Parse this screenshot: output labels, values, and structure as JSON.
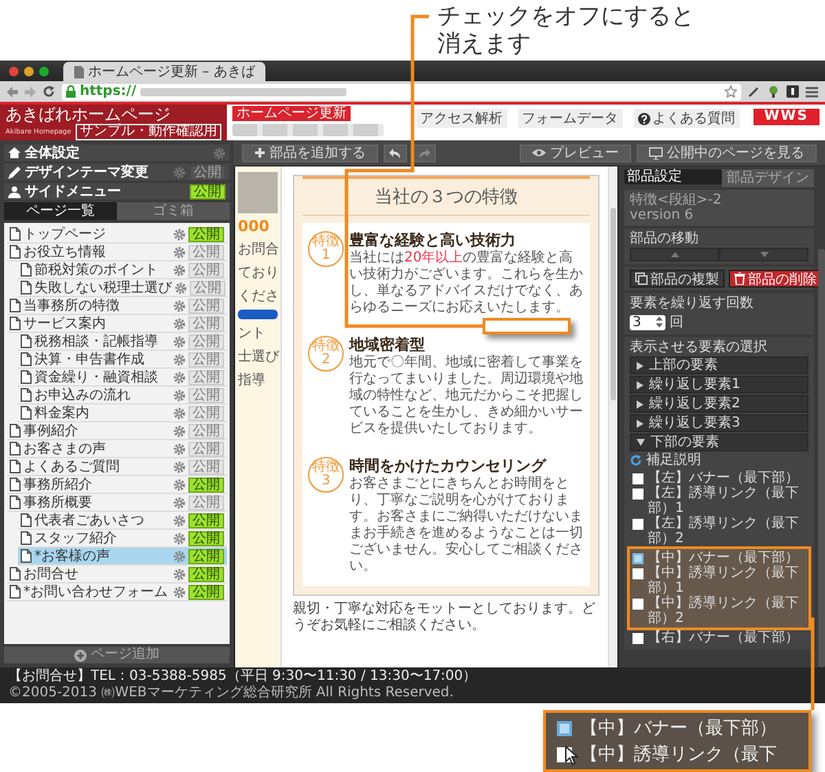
{
  "annotation": {
    "lines": [
      "チェックをオフにすると",
      "消えます"
    ]
  },
  "browser": {
    "tab_title": "ホームページ更新 – あきば",
    "url_scheme": "https://"
  },
  "site_header": {
    "logo_title": "あきばれホームページ",
    "logo_subtitle": "Akibare Homepage",
    "logo_badge": "サンプル・動作確認用",
    "tag": "ホームページ更新",
    "links": [
      {
        "label": "アクセス解析",
        "kind": "plain"
      },
      {
        "label": "フォームデータ",
        "kind": "plain"
      },
      {
        "label": "よくある質問",
        "kind": "help"
      }
    ],
    "brand": "WWS"
  },
  "sidebar": {
    "settings": [
      {
        "label": "全体設定",
        "kind": "home",
        "settings_icon": true
      },
      {
        "label": "デザインテーマ変更",
        "kind": "pen",
        "settings_icon": true,
        "status": "公開",
        "published": false
      },
      {
        "label": "サイドメニュー",
        "kind": "menu",
        "settings_icon": false,
        "status": "公開",
        "published": true
      }
    ],
    "tabs": [
      {
        "label": "ページ一覧",
        "selected": true
      },
      {
        "label": "ゴミ箱",
        "selected": false
      }
    ],
    "pages": [
      {
        "title": "トップページ",
        "status": "公開",
        "published": true,
        "selected": false
      },
      {
        "title": "お役立ち情報",
        "status": "公開",
        "published": false,
        "selected": false,
        "children": [
          {
            "title": "節税対策のポイント",
            "status": "公開",
            "published": false,
            "selected": false
          },
          {
            "title": "失敗しない税理士選び",
            "status": "公開",
            "published": false,
            "selected": false
          }
        ]
      },
      {
        "title": "当事務所の特徴",
        "status": "公開",
        "published": false,
        "selected": false
      },
      {
        "title": "サービス案内",
        "status": "公開",
        "published": false,
        "selected": false,
        "children": [
          {
            "title": "税務相談・記帳指導",
            "status": "公開",
            "published": false,
            "selected": false
          },
          {
            "title": "決算・申告書作成",
            "status": "公開",
            "published": false,
            "selected": false
          },
          {
            "title": "資金繰り・融資相談",
            "status": "公開",
            "published": false,
            "selected": false
          },
          {
            "title": "お申込みの流れ",
            "status": "公開",
            "published": false,
            "selected": false
          },
          {
            "title": "料金案内",
            "status": "公開",
            "published": false,
            "selected": false
          }
        ]
      },
      {
        "title": "事例紹介",
        "status": "公開",
        "published": false,
        "selected": false
      },
      {
        "title": "お客さまの声",
        "status": "公開",
        "published": false,
        "selected": false
      },
      {
        "title": "よくあるご質問",
        "status": "公開",
        "published": false,
        "selected": false
      },
      {
        "title": "事務所紹介",
        "status": "公開",
        "published": true,
        "selected": false
      },
      {
        "title": "事務所概要",
        "status": "公開",
        "published": false,
        "selected": false,
        "children": [
          {
            "title": "代表者ごあいさつ",
            "status": "公開",
            "published": true,
            "selected": false
          },
          {
            "title": "スタッフ紹介",
            "status": "公開",
            "published": true,
            "selected": false
          },
          {
            "title": "*お客様の声",
            "status": "公開",
            "published": true,
            "selected": true
          }
        ]
      },
      {
        "title": "お問合せ",
        "status": "公開",
        "published": true,
        "selected": false
      },
      {
        "title": "*お問い合わせフォーム",
        "status": "公開",
        "published": true,
        "selected": false
      }
    ],
    "add_page": "ページ追加"
  },
  "toolbar": {
    "add_part": "部品を追加する",
    "preview": "プレビュー",
    "view_live": "公開中のページを見る"
  },
  "preview": {
    "side_fragments": [
      "000",
      "お問合",
      "ており",
      "くださ",
      "ント",
      "士選び",
      "指導"
    ],
    "heading": "当社の３つの特徴",
    "features": [
      {
        "badge": "特徴",
        "number": "1",
        "title": "豊富な経験と高い技術力",
        "body": [
          {
            "text": "当社には",
            "highlight": false
          },
          {
            "text": "20年以上",
            "highlight": true
          },
          {
            "text": "の豊富な経験と高い技術力がございます。これらを生かし、単なるアドバイスだけでなく、あらゆるニーズにお応えいたします。",
            "highlight": false
          }
        ]
      },
      {
        "badge": "特徴",
        "number": "2",
        "title": "地域密着型",
        "body": [
          {
            "text": "地元で〇年間、地域に密着して事業を行なってまいりました。周辺環境や地域の特性など、地元だからこそ把握していることを生かし、きめ細かいサービスを提供いたしております。",
            "highlight": false
          }
        ]
      },
      {
        "badge": "特徴",
        "number": "3",
        "title": "時間をかけたカウンセリング",
        "body": [
          {
            "text": "お客さまごとにきちんとお時間をとり、丁寧なご説明を心がけております。お客さまにご納得いただけないままお手続きを進めるようなことは一切ございません。安心してご相談ください。",
            "highlight": false
          }
        ]
      }
    ],
    "closing": "親切・丁寧な対応をモットーとしております。どうぞお気軽にご相談ください。"
  },
  "right_panel": {
    "tabs": [
      {
        "label": "部品設定",
        "selected": true
      },
      {
        "label": "部品デザイン",
        "selected": false
      }
    ],
    "info": [
      "特徴<段組>-2",
      "version 6"
    ],
    "move_title": "部品の移動",
    "duplicate": "部品の複製",
    "delete": "部品の削除",
    "repeat_title": "要素を繰り返す回数",
    "repeat_value": "3",
    "repeat_unit": "回",
    "select_title": "表示させる要素の選択",
    "groups": [
      {
        "label": "上部の要素",
        "expanded": false
      },
      {
        "label": "繰り返し要素1",
        "expanded": false
      },
      {
        "label": "繰り返し要素2",
        "expanded": false
      },
      {
        "label": "繰り返し要素3",
        "expanded": false
      },
      {
        "label": "下部の要素",
        "expanded": true
      }
    ],
    "note": "補足説明",
    "element_groups": [
      {
        "highlighted": false,
        "items": [
          {
            "label": "【左】バナー（最下部）",
            "checked": true
          },
          {
            "label": "【左】誘導リンク（最下部）1",
            "checked": true
          },
          {
            "label": "【左】誘導リンク（最下部）2",
            "checked": true
          }
        ]
      },
      {
        "highlighted": true,
        "items": [
          {
            "label": "【中】バナー（最下部）",
            "checked": false
          },
          {
            "label": "【中】誘導リンク（最下部）1",
            "checked": true
          },
          {
            "label": "【中】誘導リンク（最下部）2",
            "checked": true
          }
        ]
      },
      {
        "highlighted": false,
        "items": [
          {
            "label": "【右】バナー（最下部）",
            "checked": true
          }
        ]
      }
    ]
  },
  "footer": {
    "contact": "【お問合せ】TEL：03-5388-5985（平日 9:30〜11:30 / 13:30〜17:00）",
    "copyright": "©2005-2013 ㈱WEBマーケティング総合研究所 All Rights Reserved."
  },
  "callout": {
    "items": [
      {
        "label": "【中】バナー（最下部）",
        "checked": false
      },
      {
        "label": "【中】誘導リンク（最下",
        "checked": true
      }
    ]
  }
}
